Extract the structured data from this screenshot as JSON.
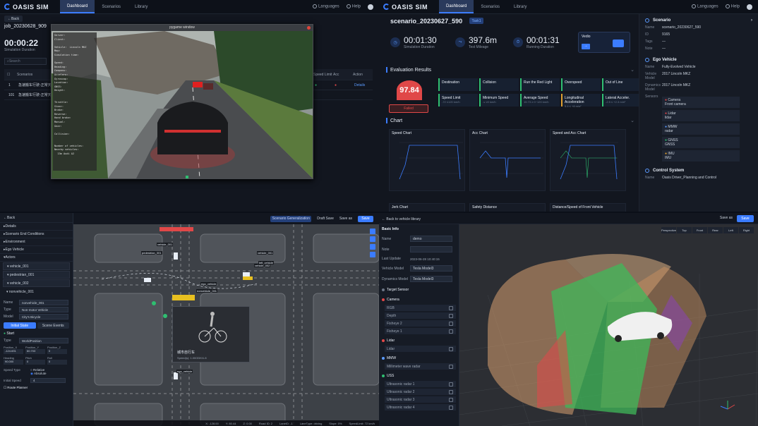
{
  "q1": {
    "brand": "OASIS SIM",
    "nav": [
      "Dashboard",
      "Scenarios",
      "Library"
    ],
    "right": [
      "Languages",
      "Help"
    ],
    "back": "Back",
    "job_id": "job_20230628_909",
    "time": "00:00:22",
    "time_label": "Simulation Duration",
    "search_placeholder": "Search",
    "table_headers": [
      "Scenarios",
      "Speed Limit",
      "Acc",
      "Action"
    ],
    "rows": [
      {
        "idx": "1",
        "name": "急速搬车行驶-正常天气",
        "action": "Details"
      },
      {
        "idx": "101",
        "name": "急速搬车行驶-正常天气",
        "action": ""
      }
    ],
    "window_title": "pygame window",
    "hud": "Server:\nClient:\n\nVehicle:  Lincoln MKZ\nMap:\nSimulation time:\n\nSpeed:\nHeading:\nCompass:\nAccelero:\nGyroscop:\nLocation:\nGNSS:\nHeight:\n\n\nThrottle:\nSteer:\nBrake:\nReverse:\nHand brake:\nManual:\nGear:\n\nCollision:\n\n\nNumber of vehicles:\nNearby vehicles:\n  13m Audi A2"
  },
  "q2": {
    "brand": "OASIS SIM",
    "nav": [
      "Dashboard",
      "Scenarios",
      "Library"
    ],
    "right": [
      "Languages",
      "Help"
    ],
    "title": "scenario_20230627_590",
    "tag": "Task1",
    "metrics": [
      {
        "value": "00:01:30",
        "label": "Simulation Duration"
      },
      {
        "value": "397.6m",
        "label": "Test Mileage"
      },
      {
        "value": "00:01:31",
        "label": "Running Duration"
      }
    ],
    "vcard_label": "Vedio",
    "eval_title": "Evaluation Results",
    "score": "97.84",
    "status": "Failed",
    "criteria": [
      {
        "name": "Destination",
        "sub": ""
      },
      {
        "name": "Collision",
        "sub": ""
      },
      {
        "name": "Run the Red Light",
        "sub": ""
      },
      {
        "name": "Overspeed",
        "sub": ""
      },
      {
        "name": "Out of Line",
        "sub": ""
      },
      {
        "name": "Speed Limit",
        "sub": "-72 ≤120 km/h"
      },
      {
        "name": "Minimum Speed",
        "sub": "-v ≥0 km/h"
      },
      {
        "name": "Average Speed",
        "sub": "15.73 ≥ 0~120 km/h"
      },
      {
        "name": "Longitudinal Acceleration",
        "sub": "5.4 ≤ +8 m/s²"
      },
      {
        "name": "Lateral Acceler.",
        "sub": "-2.5 ≤ +2.3 m/s²"
      }
    ],
    "chart_title": "Chart",
    "charts": [
      "Speed Chart",
      "Acc Chart",
      "Speed and Acc Chart"
    ],
    "charts2": [
      "Jerk Chart",
      "Safety Distance",
      "Distance/Speed of Front Vehicle"
    ],
    "side": {
      "scenario_h": "Scenario",
      "scenario": [
        {
          "k": "Name",
          "v": "scenario_20230627_590"
        },
        {
          "k": "ID",
          "v": "9165"
        },
        {
          "k": "Tags",
          "v": "—"
        },
        {
          "k": "Note",
          "v": "—"
        }
      ],
      "ego_h": "Ego Vehicle",
      "ego": [
        {
          "k": "Name",
          "v": "Fully-Evolved Vehicle"
        },
        {
          "k": "Vehicle Model",
          "v": "2017 Lincoln MKZ"
        },
        {
          "k": "Dynamics Model",
          "v": "2017 Lincoln MKZ"
        }
      ],
      "sensors_k": "Sensors",
      "sensors": [
        {
          "g": "Camera",
          "items": [
            "Front camera"
          ],
          "c": "#e04848"
        },
        {
          "g": "Lidar",
          "items": [
            "lidar"
          ],
          "c": "#e04848"
        },
        {
          "g": "MMW",
          "items": [
            "radar"
          ],
          "c": "#5b9bff"
        },
        {
          "g": "GNSS",
          "items": [
            "GNSS"
          ],
          "c": "#2fbf71"
        },
        {
          "g": "IMU",
          "items": [
            "IMU"
          ],
          "c": "#e0a030"
        }
      ],
      "ctrl_h": "Control System",
      "ctrl": [
        {
          "k": "Name",
          "v": "Oasis Driver_Planning and Control"
        }
      ]
    }
  },
  "q3": {
    "back": "Back",
    "items": [
      "Details",
      "Scenario End Conditions",
      "Environment",
      "Ego Vehicle",
      "Actors"
    ],
    "actors": [
      "vehicle_001",
      "pedestrian_001",
      "vehicle_002",
      "nonvehicle_001"
    ],
    "name_k": "Name",
    "name_v": "nonvehicle_001",
    "type_k": "Type",
    "type_v": "Non-motor Vehicle",
    "model_k": "Model",
    "model_v": "City's Bicycle",
    "tabs": [
      "Initial State",
      "Scene Events"
    ],
    "start": "Start",
    "pos_type": "WorldPosition",
    "pos_labels": [
      "Position_X",
      "Position_Y",
      "Position_Z"
    ],
    "pos_vals": [
      "-124.691",
      "60.703",
      "0"
    ],
    "hdg_labels": [
      "Heading",
      "Pitch",
      "Roll"
    ],
    "hdg_vals": [
      "90.000",
      "0",
      "0"
    ],
    "speed_type": "Speed Type",
    "relative": "Relative",
    "absolute": "Absolute",
    "init_speed": "Initial Speed",
    "init_speed_v": "4",
    "route": "Route Planner",
    "top_btns": [
      "Scenario Generalization",
      "Draft Save",
      "Save as",
      "Save"
    ],
    "popup_title": "城市自行车",
    "popup_sub": "Speed(s): 1.00ODKt1.8",
    "labels": [
      "vehicle_001",
      "vehicle_001",
      "pedestrian_001",
      "vehicle_002",
      "ego_vehicle",
      "nonvehicle_001",
      "left_vehicle",
      "ego_vehicle"
    ],
    "status": [
      "X: -128.00",
      "Y: 80.44",
      "Z: 0.00",
      "Road ID: 2",
      "LaneID: -1",
      "LaneType: driving",
      "Slope: 0%",
      "SpeedLimit: 72 km/h"
    ]
  },
  "q4": {
    "back": "Back to vehicle library",
    "save_as": "Save as",
    "save": "Save",
    "basic": "Basic Info",
    "name_k": "Name",
    "name_v": "demo",
    "note_k": "Note",
    "last_k": "Last Update",
    "last_v": "2023-06-28 10:40:15",
    "veh_k": "Vehicle Model",
    "veh_v": "Tesla Model3",
    "dyn_k": "Dynamics Model",
    "dyn_v": "Tesla Model3",
    "target": "Target Sensor",
    "groups": [
      {
        "g": "Camera",
        "c": "#e04848",
        "items": [
          "RGB",
          "Depth",
          "Fisheye 2",
          "Fisheye 1"
        ]
      },
      {
        "g": "Lidar",
        "c": "#e04848",
        "items": [
          "Lidar"
        ]
      },
      {
        "g": "MMW",
        "c": "#5b9bff",
        "items": [
          "Millimeter wave radar"
        ]
      },
      {
        "g": "USS",
        "c": "#2fbf71",
        "items": [
          "Ultrasonic radar 1",
          "Ultrasonic radar 2",
          "Ultrasonic radar 3",
          "Ultrasonic radar 4"
        ]
      }
    ],
    "views": [
      "Perspective",
      "Top",
      "Front",
      "Rear",
      "Left",
      "Right"
    ]
  }
}
